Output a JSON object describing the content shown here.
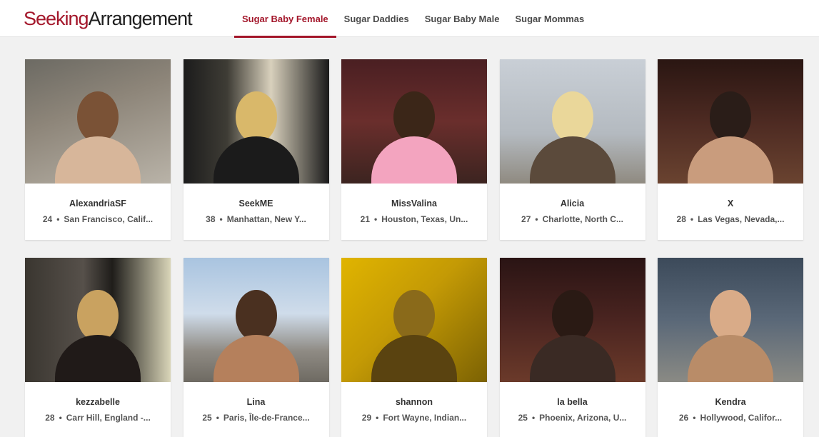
{
  "brand": {
    "part1": "Seeking",
    "part2": "Arrangement"
  },
  "nav": {
    "tabs": [
      {
        "label": "Sugar Baby Female"
      },
      {
        "label": "Sugar Daddies"
      },
      {
        "label": "Sugar Baby Male"
      },
      {
        "label": "Sugar Mommas"
      }
    ],
    "active_index": 0
  },
  "profiles": [
    {
      "name": "AlexandriaSF",
      "age": "24",
      "location": "San Francisco, Calif..."
    },
    {
      "name": "SeekME",
      "age": "38",
      "location": "Manhattan, New Y..."
    },
    {
      "name": "MissValina",
      "age": "21",
      "location": "Houston, Texas, Un..."
    },
    {
      "name": "Alicia",
      "age": "27",
      "location": "Charlotte, North C..."
    },
    {
      "name": "X",
      "age": "28",
      "location": "Las Vegas, Nevada,..."
    },
    {
      "name": "kezzabelle",
      "age": "28",
      "location": "Carr Hill, England -..."
    },
    {
      "name": "Lina",
      "age": "25",
      "location": "Paris, Île-de-France..."
    },
    {
      "name": "shannon",
      "age": "29",
      "location": "Fort Wayne, Indian..."
    },
    {
      "name": "la bella",
      "age": "25",
      "location": "Phoenix, Arizona, U..."
    },
    {
      "name": "Kendra",
      "age": "26",
      "location": "Hollywood, Califor..."
    }
  ],
  "colors": {
    "accent": "#a3162a",
    "page_bg": "#f1f1f1"
  }
}
